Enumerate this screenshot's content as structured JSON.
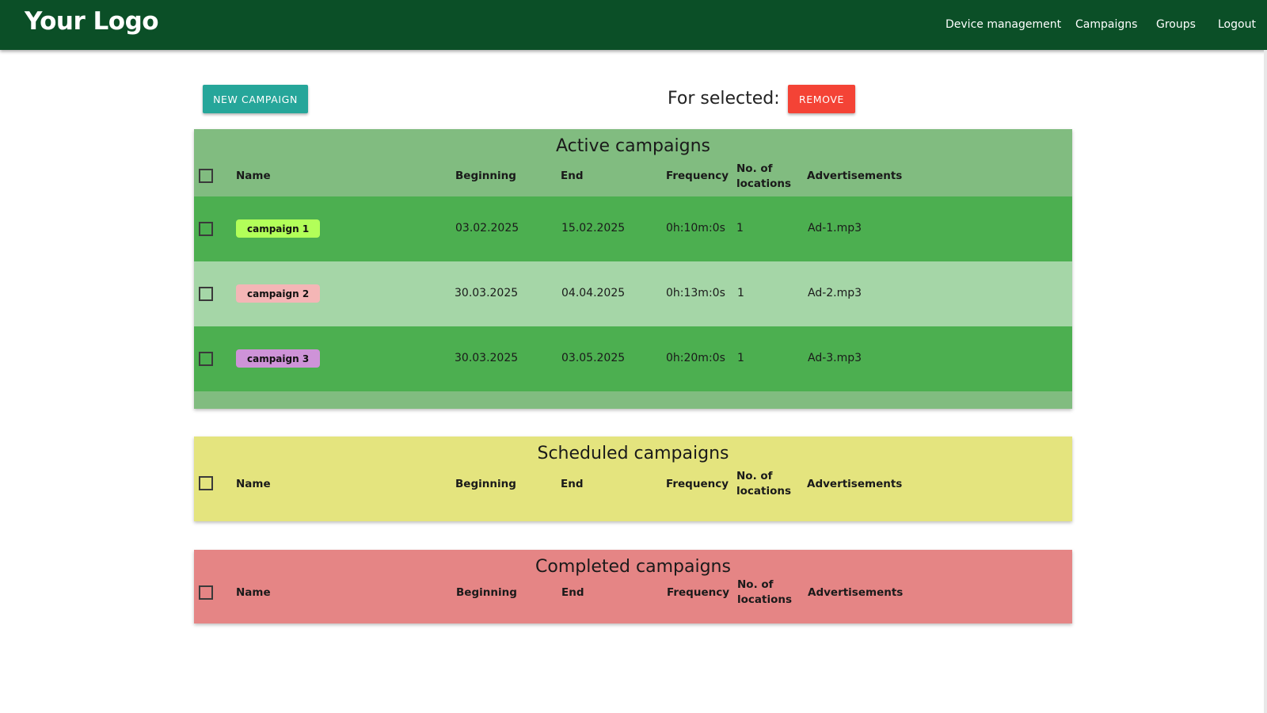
{
  "navbar": {
    "logo": "Your Logo",
    "links": [
      "Device management",
      "Campaigns",
      "Groups",
      "Logout"
    ]
  },
  "toolbar": {
    "new_campaign_label": "NEW CAMPAIGN",
    "for_selected_label": "For selected:",
    "remove_label": "REMOVE"
  },
  "columns": {
    "name": "Name",
    "beginning": "Beginning",
    "end": "End",
    "frequency": "Frequency",
    "locations_line1": "No. of",
    "locations_line2": "locations",
    "advertisements": "Advertisements"
  },
  "active": {
    "title": "Active campaigns",
    "rows": [
      {
        "name": "campaign 1",
        "chip_color": "#b2ff59",
        "beginning": "03.02.2025",
        "end": "15.02.2025",
        "frequency": "0h:10m:0s",
        "locations": "1",
        "ads": "Ad-1.mp3"
      },
      {
        "name": "campaign 2",
        "chip_color": "#f4b6b6",
        "beginning": "30.03.2025",
        "end": "04.04.2025",
        "frequency": "0h:13m:0s",
        "locations": "1",
        "ads": "Ad-2.mp3"
      },
      {
        "name": "campaign 3",
        "chip_color": "#ce93d8",
        "beginning": "30.03.2025",
        "end": "03.05.2025",
        "frequency": "0h:20m:0s",
        "locations": "1",
        "ads": "Ad-3.mp3"
      }
    ]
  },
  "scheduled": {
    "title": "Scheduled campaigns"
  },
  "completed": {
    "title": "Completed campaigns"
  },
  "colors": {
    "navbar": "#0b4f27",
    "new_button": "#26a69a",
    "remove_button": "#f44336",
    "active_panel": "#81bc80",
    "active_row_dark": "#4caf50",
    "active_row_light": "#a5d6a7",
    "scheduled_panel": "#e4e47e",
    "completed_panel": "#e58585"
  }
}
